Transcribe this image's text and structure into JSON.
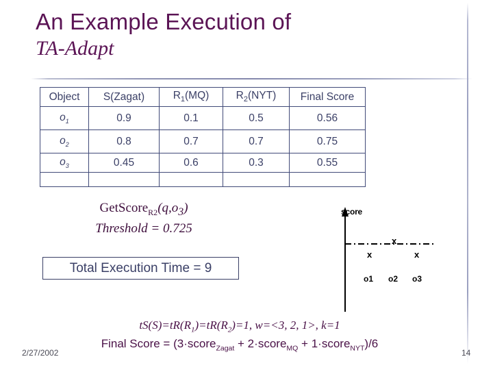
{
  "slide": {
    "title_line1": "An Example Execution of",
    "title_line2": "TA-Adapt",
    "title_color": "#5b1455",
    "accent_color": "#3a3f66"
  },
  "table": {
    "headers": [
      {
        "text": "Object",
        "sub": ""
      },
      {
        "text": "S(Zagat)",
        "sub": ""
      },
      {
        "text": "R",
        "sub": "1",
        "tail": "(MQ)"
      },
      {
        "text": "R",
        "sub": "2",
        "tail": "(NYT)"
      },
      {
        "text": "Final Score",
        "sub": ""
      }
    ],
    "header_labels": {
      "object": "Object",
      "zagat": "S(Zagat)",
      "mq_base": "R",
      "mq_sub": "1",
      "mq_tail": "(MQ)",
      "nyt_base": "R",
      "nyt_sub": "2",
      "nyt_tail": "(NYT)",
      "final": "Final Score"
    },
    "rows": [
      {
        "obj_base": "o",
        "obj_sub": "1",
        "zagat": "0.9",
        "mq": "0.1",
        "nyt": "0.5",
        "final": "0.56"
      },
      {
        "obj_base": "o",
        "obj_sub": "2",
        "zagat": "0.8",
        "mq": "0.7",
        "nyt": "0.7",
        "final": "0.75"
      },
      {
        "obj_base": "o",
        "obj_sub": "3",
        "zagat": "0.45",
        "mq": "0.6",
        "nyt": "0.3",
        "final": "0.55"
      }
    ]
  },
  "getscore": {
    "prefix": "GetScore",
    "subscript": "R2",
    "args": "(q,o",
    "args_sub": "3",
    "args_close": ")",
    "threshold": "Threshold = 0.725"
  },
  "exec_time": {
    "label": "Total Execution Time = 9"
  },
  "diagram": {
    "axis_label": "score",
    "markers": [
      {
        "label": "x",
        "object": "o1"
      },
      {
        "label": "x",
        "object": "o2"
      },
      {
        "label": "x",
        "object": "o3"
      }
    ],
    "object_labels": [
      "o1",
      "o2",
      "o3"
    ],
    "marker_x": "x"
  },
  "formulas": {
    "params_a": "tS(S)=tR(R",
    "params_sub1": "1",
    "params_b": ")=tR(R",
    "params_sub2": "2",
    "params_c": ")=1, w=<3, 2, 1>, k=1",
    "final_a": "Final Score = (3",
    "final_dot1": "·",
    "final_score1": "score",
    "final_sub1": "Zagat",
    "final_plus1": " + 2",
    "final_score2": "score",
    "final_sub2": "MQ",
    "final_plus2": " + 1",
    "final_score3": "score",
    "final_sub3": "NYT",
    "final_end": ")/6"
  },
  "footer": {
    "date": "2/27/2002",
    "slide_number": "14"
  }
}
